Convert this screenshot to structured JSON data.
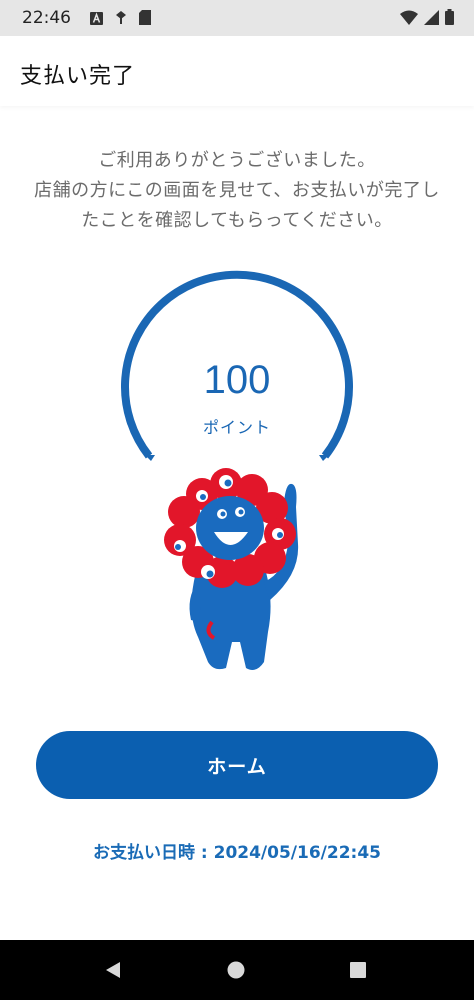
{
  "status_bar": {
    "time": "22:46",
    "left_icons": [
      "a-notification-icon",
      "vpn-key-icon",
      "sd-card-icon"
    ],
    "right_icons": [
      "wifi-icon",
      "signal-icon",
      "battery-icon"
    ]
  },
  "app_bar": {
    "title": "支払い完了"
  },
  "message": {
    "lines": [
      "ご利用ありがとうございました。",
      "店舗の方にこの画面を見せて、お支払いが完了し",
      "たことを確認してもらってください。"
    ]
  },
  "points": {
    "value": "100",
    "unit": "ポイント"
  },
  "mascot": {
    "icon": "mascot-character-icon"
  },
  "home_button": {
    "label": "ホーム"
  },
  "payment": {
    "datetime_text": "お支払い日時 : 2024/05/16/22:45"
  },
  "colors": {
    "accent": "#0b5fb0",
    "gauge": "#1a67b4",
    "text_gray": "#6b6b6b",
    "mascot_red": "#e2162a",
    "mascot_blue": "#1a6bbf"
  },
  "nav_bar": {
    "icons": [
      "back-icon",
      "home-icon",
      "recents-icon"
    ]
  }
}
